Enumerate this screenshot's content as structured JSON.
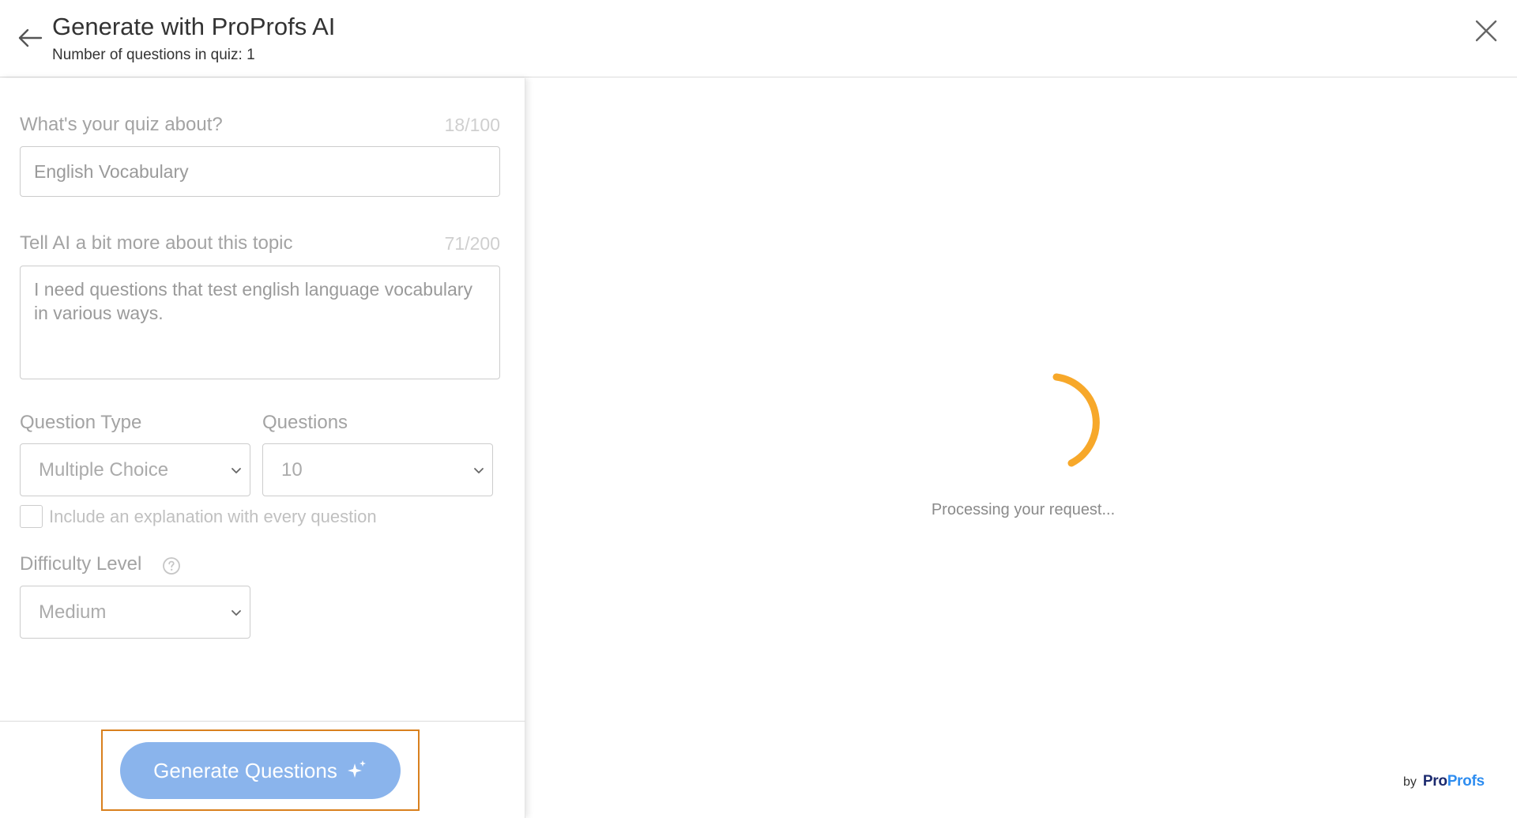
{
  "header": {
    "title": "Generate with ProProfs AI",
    "subtitle": "Number of questions in quiz: 1"
  },
  "form": {
    "topic": {
      "label": "What's your quiz about?",
      "counter": "18/100",
      "value": "English Vocabulary"
    },
    "details": {
      "label": "Tell AI a bit more about this topic",
      "counter": "71/200",
      "value": "I need questions that test english language vocabulary in various ways."
    },
    "question_type": {
      "label": "Question Type",
      "selected": "Multiple Choice"
    },
    "questions": {
      "label": "Questions",
      "selected": "10"
    },
    "explanation_checkbox": {
      "label": "Include an explanation with every question",
      "checked": false
    },
    "difficulty": {
      "label": "Difficulty Level",
      "selected": "Medium"
    }
  },
  "actions": {
    "generate_label": "Generate Questions"
  },
  "status": {
    "processing_text": "Processing your request..."
  },
  "brand": {
    "by": "by",
    "name_part1": "Pro",
    "name_part2": "Profs"
  },
  "colors": {
    "accent_button": "#8ab4ec",
    "spinner": "#f7a82a",
    "highlight_border": "#d9801e",
    "brand_dark": "#1c2a6e",
    "brand_blue": "#2e8df0"
  }
}
